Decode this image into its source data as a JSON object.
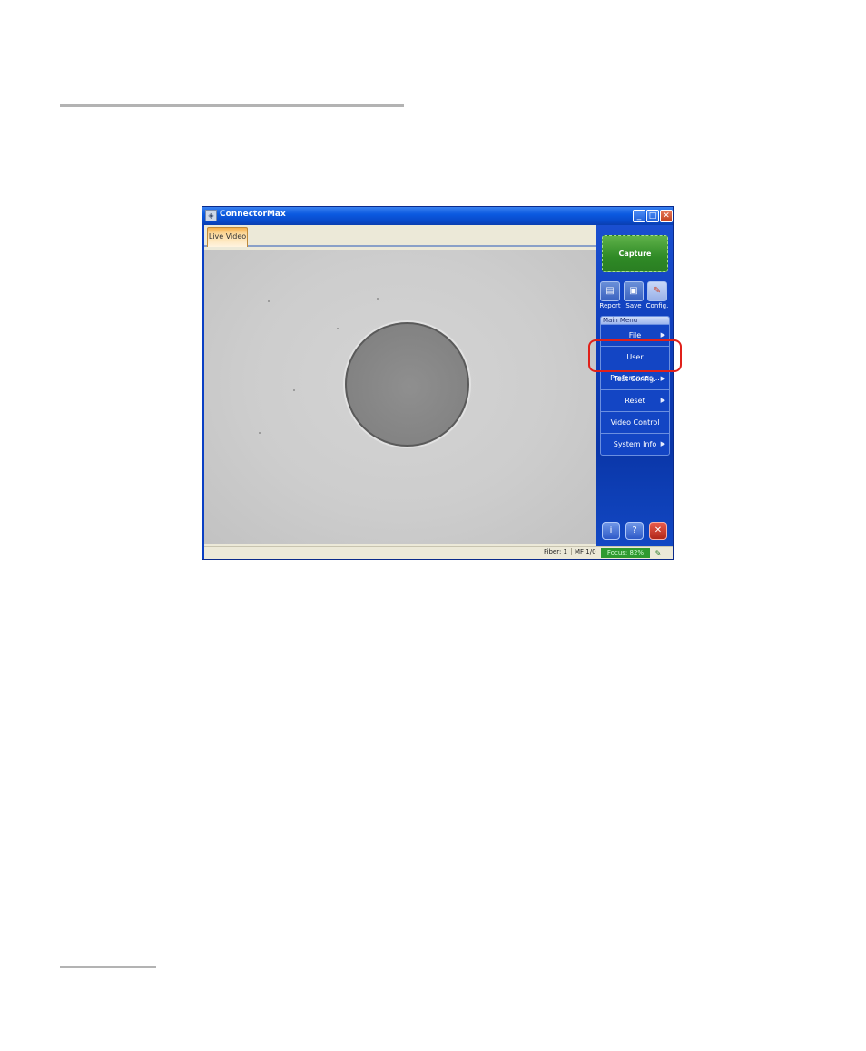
{
  "window": {
    "title": "ConnectorMax",
    "buttons": {
      "minimize": "_",
      "maximize": "□",
      "close": "✕"
    }
  },
  "tabs": [
    {
      "label": "Live Video"
    }
  ],
  "right_panel": {
    "capture_label": "Capture",
    "toolbar": [
      {
        "label": "Report",
        "icon": "report-icon"
      },
      {
        "label": "Save",
        "icon": "save-icon"
      },
      {
        "label": "Config.",
        "icon": "config-icon"
      }
    ],
    "main_menu": {
      "title": "Main Menu",
      "items": [
        {
          "label": "File",
          "submenu": true
        },
        {
          "label": "User Preferences...",
          "submenu": false
        },
        {
          "label": "Test Config.",
          "submenu": true
        },
        {
          "label": "Reset",
          "submenu": true
        },
        {
          "label": "Video Control",
          "submenu": false
        },
        {
          "label": "System Info",
          "submenu": true
        }
      ]
    },
    "bottom_buttons": [
      {
        "icon": "info-icon",
        "glyph": "i"
      },
      {
        "icon": "help-icon",
        "glyph": "?"
      },
      {
        "icon": "exit-icon",
        "glyph": "✕"
      }
    ]
  },
  "status_bar": {
    "fiber": "Fiber: 1",
    "mode": "MF 1/0",
    "focus": "Focus: 82%"
  },
  "colors": {
    "panel_blue": "#0e3cb8",
    "capture_green": "#2f8a26",
    "highlight_red": "#e0201a",
    "focus_green": "#2f9a2f"
  }
}
